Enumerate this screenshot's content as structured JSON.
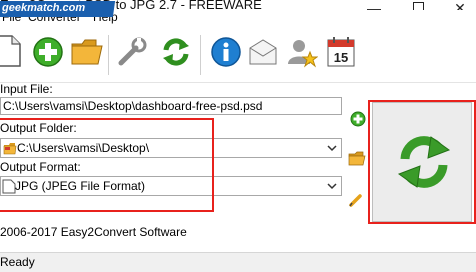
{
  "window": {
    "title": "Easy2Convert PSD to JPG 2.7 - FREEWARE",
    "minimize_glyph": "—",
    "close_glyph": "✕"
  },
  "watermark": {
    "text": "geekmatch.com"
  },
  "menu": {
    "items": [
      "File",
      "Converter",
      "Help"
    ]
  },
  "toolbar": {
    "icons": [
      "new-file-icon",
      "add-icon",
      "open-folder-icon",
      "settings-wrench-icon",
      "refresh-icon",
      "info-icon",
      "mail-icon",
      "user-star-icon",
      "calendar-icon"
    ],
    "calendar_day": "15"
  },
  "input_file": {
    "label": "Input File:",
    "value": "C:\\Users\\vamsi\\Desktop\\dashboard-free-psd.psd"
  },
  "output_folder": {
    "label": "Output Folder:",
    "value": "C:\\Users\\vamsi\\Desktop\\"
  },
  "output_format": {
    "label": "Output Format:",
    "value": "JPG (JPEG File Format)"
  },
  "colors": {
    "highlight_red": "#e8211c",
    "accent_green": "#3a9b29"
  },
  "copyright": "2006-2017 Easy2Convert Software",
  "status": {
    "text": "Ready"
  }
}
